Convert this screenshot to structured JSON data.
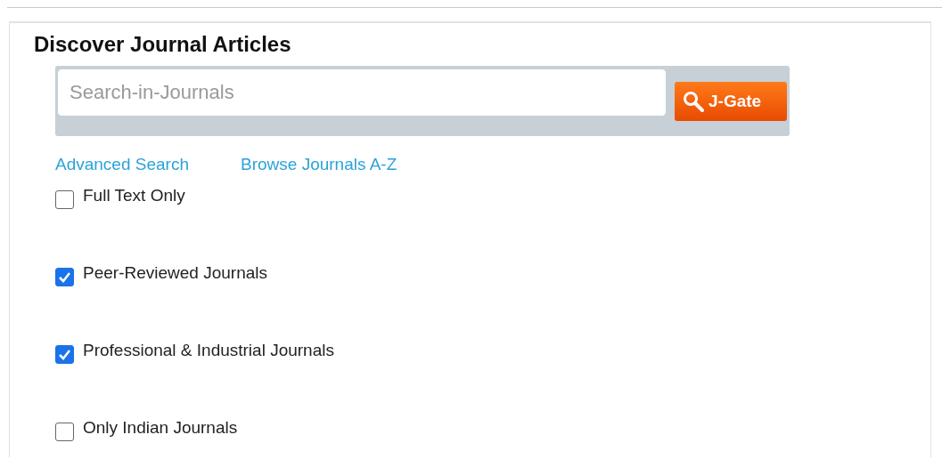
{
  "title": "Discover Journal Articles",
  "search": {
    "placeholder": "Search-in-Journals",
    "button_label": "J-Gate"
  },
  "links": [
    "Advanced Search",
    "Browse Journals A-Z"
  ],
  "filters": [
    {
      "label": "Full Text Only",
      "checked": false
    },
    {
      "label": "Peer-Reviewed Journals",
      "checked": true
    },
    {
      "label": "Professional & Industrial Journals",
      "checked": true
    },
    {
      "label": "Only Indian Journals",
      "checked": false
    }
  ]
}
